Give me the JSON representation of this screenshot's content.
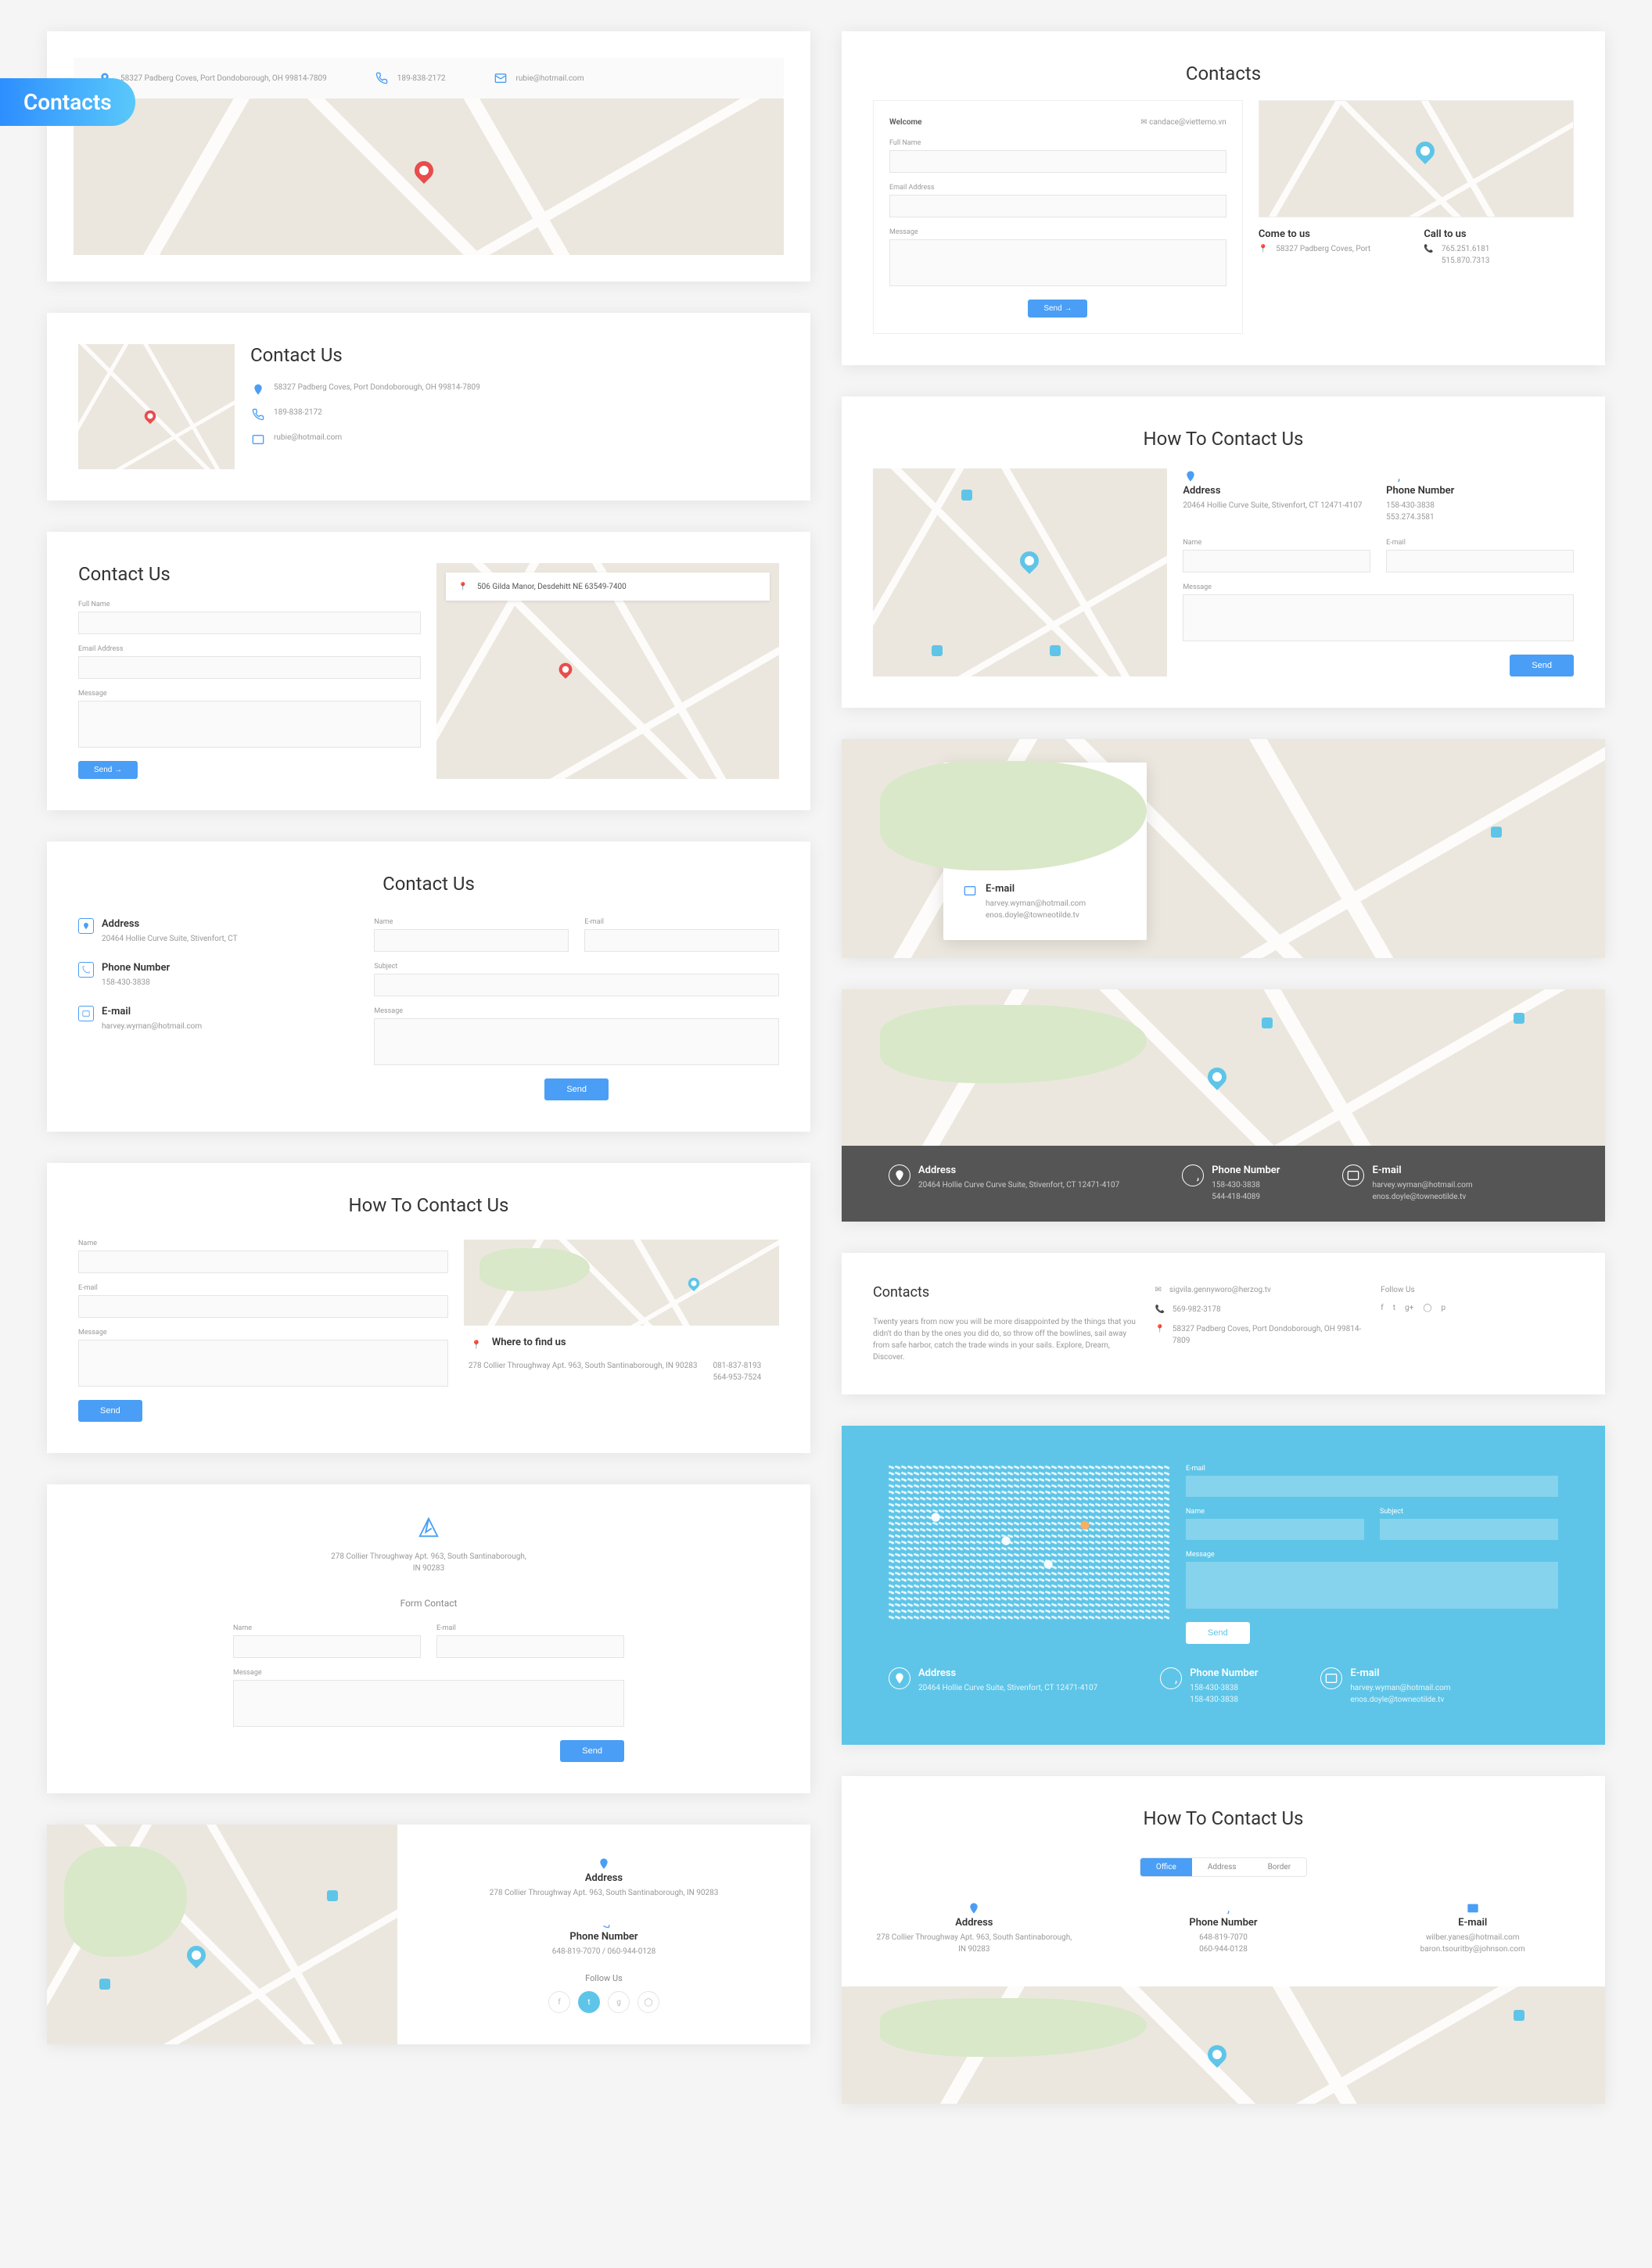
{
  "badge": "Contacts",
  "titles": {
    "contacts": "Contacts",
    "contact_us": "Contact Us",
    "how_to": "How To Contact Us",
    "form_contact": "Form Contact",
    "come_to_us": "Come to us",
    "call_to_us": "Call to us",
    "where_to_find": "Where to find us",
    "follow_us": "Follow Us",
    "welcome": "Welcome"
  },
  "labels": {
    "address": "Address",
    "phone": "Phone Number",
    "email": "E-mail",
    "name": "Name",
    "email_addr": "Email Address",
    "full_name": "Full Name",
    "message": "Message",
    "subject": "Subject",
    "send": "Send",
    "office": "Office",
    "address_tab": "Address",
    "border": "Border"
  },
  "c1": {
    "address": "58327 Padberg Coves, Port Dondoborough, OH 99814-7809",
    "phone": "189-838-2172",
    "email": "rubie@hotmail.com"
  },
  "c2": {
    "email_icon": "candace@viettemo.vn",
    "address": "58327 Padberg Coves, Port",
    "phone1": "765.251.6181",
    "phone2": "515.870.7313"
  },
  "c3": {
    "address": "58327 Padberg Coves, Port Dondoborough, OH 99814-7809",
    "phone": "189-838-2172",
    "email": "rubie@hotmail.com"
  },
  "c4": {
    "address": "20464 Hollie Curve Suite, Stivenfort, CT 12471-4107",
    "phone1": "158-430-3838",
    "phone2": "553.274.3581"
  },
  "c5": {
    "strip": "506 Gilda Manor, Desdehitt NE 63549-7400"
  },
  "c6": {
    "address": "20464 Hollie Curve Suite, Stivenfort, CT 12471-4107",
    "phone1": "158-430-3838",
    "phone2": "544-418-4089",
    "email1": "harvey.wyman@hotmail.com",
    "email2": "enos.doyle@towneotilde.tv"
  },
  "c7": {
    "address": "20464 Hollie Curve Suite, Stivenfort, CT",
    "phone": "158-430-3838",
    "email": "harvey.wyman@hotmail.com"
  },
  "c8": {
    "address": "20464 Hollie Curve Curve Suite, Stivenfort, CT 12471-4107",
    "phone1": "158-430-3838",
    "phone2": "544-418-4089",
    "email1": "harvey.wyman@hotmail.com",
    "email2": "enos.doyle@towneotilde.tv"
  },
  "c9": {
    "address1": "278 Collier Throughway Apt. 963, South Santinaborough, IN 90283",
    "phone1": "081-837-8193",
    "phone2": "564-953-7524"
  },
  "c10": {
    "blurb": "Twenty years from now you will be more disappointed by the things that you didn't do than by the ones you did do, so throw off the bowlines, sail away from safe harbor, catch the trade winds in your sails. Explore, Dream, Discover.",
    "email": "sigvila.gennyworo@herzog.tv",
    "phone": "569-982-3178",
    "address": "58327 Padberg Coves, Port Dondoborough, OH 99814-7809"
  },
  "c11": {
    "address": "278 Collier Throughway Apt. 963, South Santinaborough, IN 90283"
  },
  "c12": {
    "address": "20464 Hollie Curve Suite, Stivenfort, CT 12471-4107",
    "phone1": "158-430-3838",
    "phone2": "158-430-3838",
    "email1": "harvey.wyman@hotmail.com",
    "email2": "enos.doyle@towneotilde.tv"
  },
  "c13": {
    "address": "278 Collier Throughway Apt. 963, South Santinaborough, IN 90283",
    "phone": "648-819-7070 / 060-944-0128"
  },
  "c14": {
    "address": "278 Collier Throughway Apt. 963, South Santinaborough, IN 90283",
    "phone": "648-819-7070\n060-944-0128",
    "email1": "wilber.yanes@hotmail.com",
    "email2": "baron.tsouritby@johnson.com"
  }
}
